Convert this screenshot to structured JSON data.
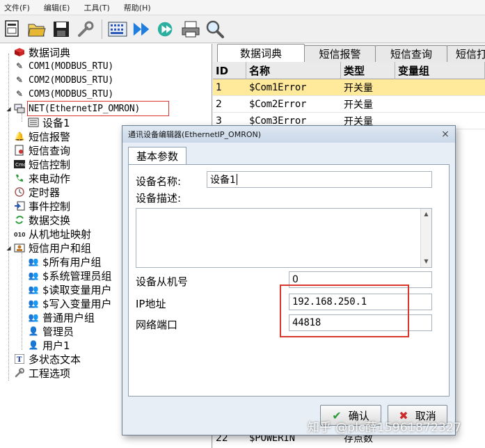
{
  "menubar": {
    "items": [
      "文件(F)",
      "编辑(E)",
      "工具(T)",
      "帮助(H)"
    ]
  },
  "toolbar": {
    "icons": [
      "new-project-icon",
      "open-folder-icon",
      "save-icon",
      "wrench-icon",
      "compile-icon",
      "run-icon",
      "download-icon",
      "print-icon",
      "search-icon"
    ]
  },
  "tree": {
    "items": [
      {
        "label": "数据词典",
        "icon": "book-icon"
      },
      {
        "label": "COM1(MODBUS_RTU)",
        "icon": "plug-icon"
      },
      {
        "label": "COM2(MODBUS_RTU)",
        "icon": "plug-icon"
      },
      {
        "label": "COM3(MODBUS_RTU)",
        "icon": "plug-icon"
      },
      {
        "label": "NET(EthernetIP_OMRON)",
        "icon": "network-icon"
      },
      {
        "label": "设备1",
        "icon": "device-icon"
      },
      {
        "label": "短信报警",
        "icon": "bell-icon"
      },
      {
        "label": "短信查询",
        "icon": "query-icon"
      },
      {
        "label": "短信控制",
        "icon": "cmd-icon"
      },
      {
        "label": "来电动作",
        "icon": "phone-icon"
      },
      {
        "label": "定时器",
        "icon": "timer-icon"
      },
      {
        "label": "事件控制",
        "icon": "event-icon"
      },
      {
        "label": "数据交换",
        "icon": "exchange-icon"
      },
      {
        "label": "从机地址映射",
        "icon": "binary-icon"
      },
      {
        "label": "短信用户和组",
        "icon": "users-group-icon"
      },
      {
        "label": "$所有用户组",
        "icon": "group-icon"
      },
      {
        "label": "$系统管理员组",
        "icon": "group-icon"
      },
      {
        "label": "$读取变量用户",
        "icon": "group-icon"
      },
      {
        "label": "$写入变量用户",
        "icon": "group-icon"
      },
      {
        "label": "普通用户组",
        "icon": "group-icon"
      },
      {
        "label": "管理员",
        "icon": "user-icon"
      },
      {
        "label": "用户1",
        "icon": "user-icon"
      },
      {
        "label": "多状态文本",
        "icon": "text-icon"
      },
      {
        "label": "工程选项",
        "icon": "settings-wrench-icon"
      }
    ]
  },
  "tabs": [
    "数据词典",
    "短信报警",
    "短信查询",
    "短信打"
  ],
  "grid": {
    "columns": [
      "ID",
      "名称",
      "类型",
      "变量组"
    ],
    "rows": [
      {
        "id": "1",
        "name": "$Com1Error",
        "type": "开关量",
        "group": ""
      },
      {
        "id": "2",
        "name": "$Com2Error",
        "type": "开关量",
        "group": ""
      },
      {
        "id": "3",
        "name": "$Com3Error",
        "type": "开关量",
        "group": ""
      }
    ],
    "bottom_row": {
      "id": "22",
      "name": "$POWERIN",
      "type": "存点数",
      "group": ""
    }
  },
  "dialog": {
    "title": "通讯设备编辑器(EthernetIP_OMRON)",
    "close": "×",
    "tab": "基本参数",
    "fields": {
      "device_name_label": "设备名称:",
      "device_name_value": "设备1",
      "device_desc_label": "设备描述:",
      "device_desc_value": "",
      "slave_id_label": "设备从机号",
      "slave_id_value": "0",
      "ip_label": "IP地址",
      "ip_value": "192.168.250.1",
      "port_label": "网络端口",
      "port_value": "44818"
    },
    "ok_label": "确认",
    "cancel_label": "取消"
  },
  "watermark": "知乎 @plc薛15961872327",
  "colors": {
    "highlight_red": "#d9362c",
    "selected_row": "#ffe99a",
    "dialog_bg": "#e8eef5"
  }
}
